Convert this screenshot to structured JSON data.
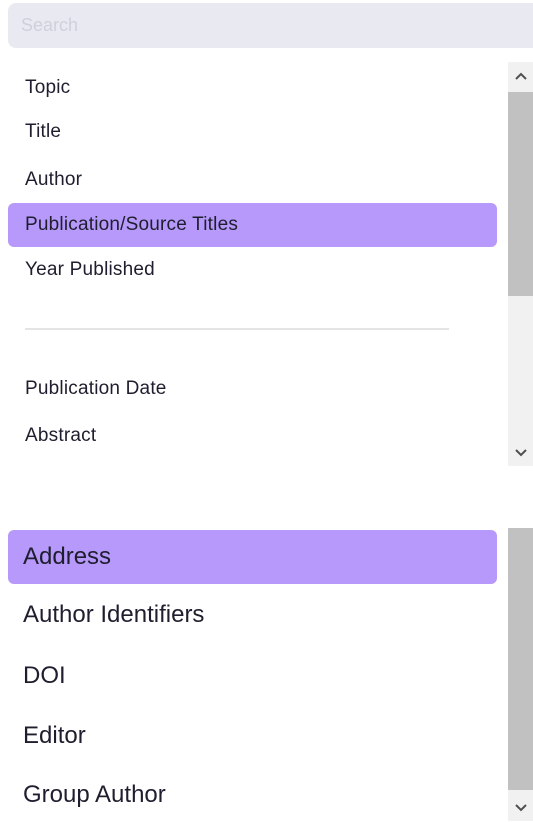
{
  "search": {
    "placeholder": "Search",
    "value": ""
  },
  "list1": {
    "items": [
      {
        "label": "Topic",
        "selected": false
      },
      {
        "label": "Title",
        "selected": false
      },
      {
        "label": "Author",
        "selected": false
      },
      {
        "label": "Publication/Source Titles",
        "selected": true
      },
      {
        "label": "Year Published",
        "selected": false
      },
      {
        "label": "Publication Date",
        "selected": false
      },
      {
        "label": "Abstract",
        "selected": false
      }
    ]
  },
  "list2": {
    "items": [
      {
        "label": "Address",
        "selected": true
      },
      {
        "label": "Author Identifiers",
        "selected": false
      },
      {
        "label": "DOI",
        "selected": false
      },
      {
        "label": "Editor",
        "selected": false
      },
      {
        "label": "Group Author",
        "selected": false
      }
    ]
  },
  "colors": {
    "selected": "#b699fa",
    "search_bg": "#e9e9f2",
    "scroll_thumb": "#c1c1c1",
    "scroll_track": "#f1f1f1"
  },
  "icons": {
    "scroll_up": "chevron-up-icon",
    "scroll_down": "chevron-down-icon"
  }
}
